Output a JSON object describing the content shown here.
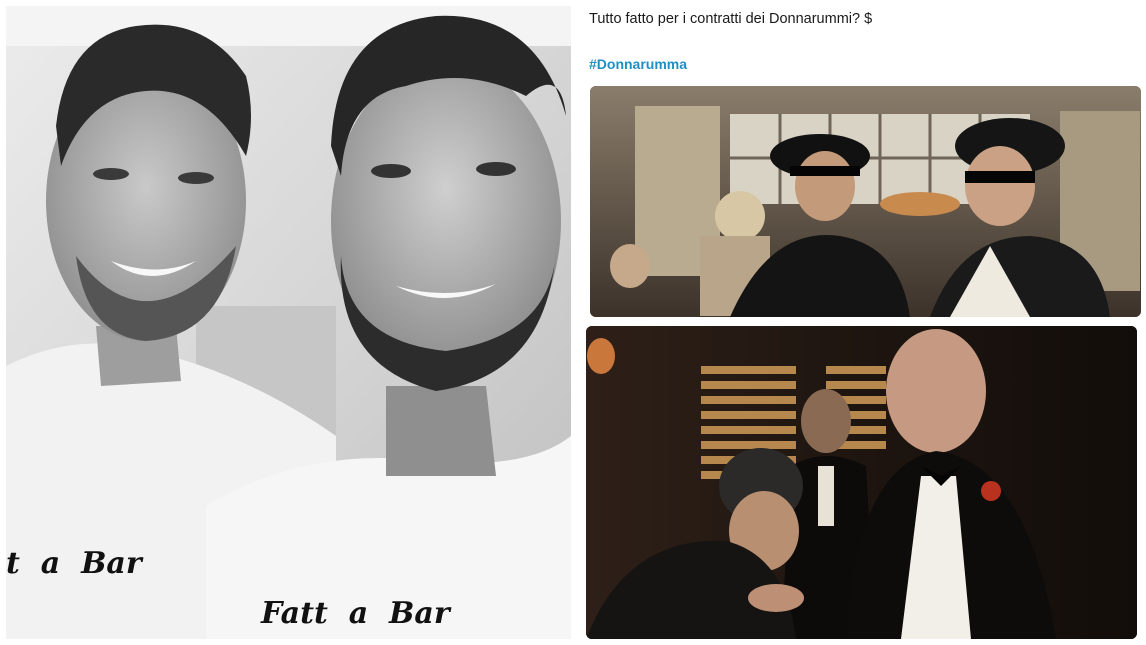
{
  "post": {
    "text": "Tutto fatto per i contratti dei Donnarummi? $",
    "hashtag": "#Donnarumma"
  },
  "shirt_prints": {
    "left_shirt": "t  a  Bar",
    "right_shirt": "Fatt  a  Bar"
  },
  "colors": {
    "hashtag": "#1f8fc4",
    "text": "#1a1a1a"
  }
}
